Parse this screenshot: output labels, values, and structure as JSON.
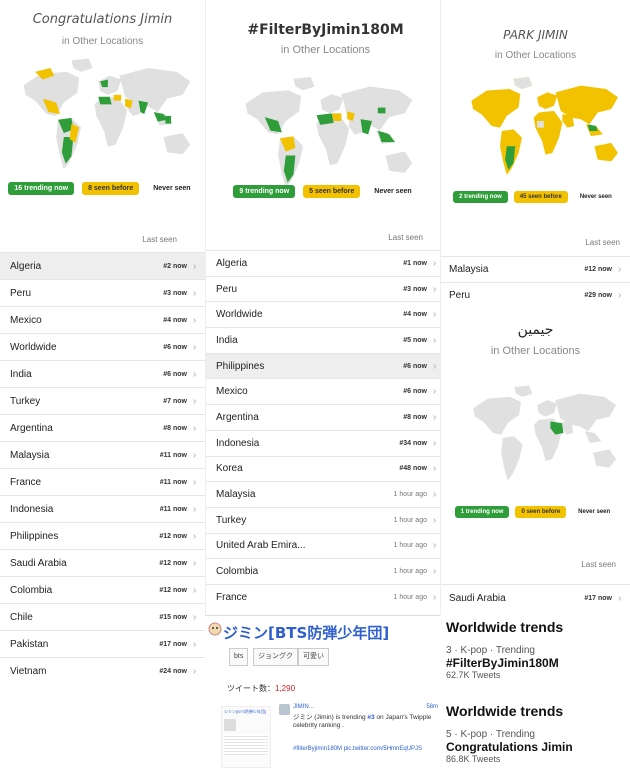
{
  "colors": {
    "green": "#2f9e3a",
    "yellow": "#f2c200",
    "land": "#e0e0e0",
    "link": "#2f5fcf"
  },
  "common": {
    "subtitle": "in Other Locations",
    "last_seen": "Last seen",
    "chevron": "›"
  },
  "panel1": {
    "title": "Congratulations Jimin",
    "legend": {
      "trending": "16 trending now",
      "before": "8 seen before",
      "never": "Never seen"
    },
    "rows": [
      {
        "name": "Algeria",
        "status": "#2 now"
      },
      {
        "name": "Peru",
        "status": "#3 now"
      },
      {
        "name": "Mexico",
        "status": "#4 now"
      },
      {
        "name": "Worldwide",
        "status": "#6 now"
      },
      {
        "name": "India",
        "status": "#6 now"
      },
      {
        "name": "Turkey",
        "status": "#7 now"
      },
      {
        "name": "Argentina",
        "status": "#8 now"
      },
      {
        "name": "Malaysia",
        "status": "#11 now"
      },
      {
        "name": "France",
        "status": "#11 now"
      },
      {
        "name": "Indonesia",
        "status": "#11 now"
      },
      {
        "name": "Philippines",
        "status": "#12 now"
      },
      {
        "name": "Saudi Arabia",
        "status": "#12 now"
      },
      {
        "name": "Colombia",
        "status": "#12 now"
      },
      {
        "name": "Chile",
        "status": "#15 now"
      },
      {
        "name": "Pakistan",
        "status": "#17 now"
      },
      {
        "name": "Vietnam",
        "status": "#24 now"
      }
    ]
  },
  "panel2": {
    "title": "#FilterByJimin180M",
    "legend": {
      "trending": "9 trending now",
      "before": "5 seen before",
      "never": "Never seen"
    },
    "rows": [
      {
        "name": "Algeria",
        "status": "#1 now"
      },
      {
        "name": "Peru",
        "status": "#3 now"
      },
      {
        "name": "Worldwide",
        "status": "#4 now"
      },
      {
        "name": "India",
        "status": "#5 now"
      },
      {
        "name": "Philippines",
        "status": "#6 now"
      },
      {
        "name": "Mexico",
        "status": "#6 now"
      },
      {
        "name": "Argentina",
        "status": "#8 now"
      },
      {
        "name": "Indonesia",
        "status": "#34 now"
      },
      {
        "name": "Korea",
        "status": "#48 now"
      },
      {
        "name": "Malaysia",
        "status": "1 hour ago"
      },
      {
        "name": "Turkey",
        "status": "1 hour ago"
      },
      {
        "name": "United Arab Emira...",
        "status": "1 hour ago"
      },
      {
        "name": "Colombia",
        "status": "1 hour ago"
      },
      {
        "name": "France",
        "status": "1 hour ago"
      }
    ]
  },
  "panel3": {
    "title": "PARK JIMIN",
    "legend": {
      "trending": "2 trending now",
      "before": "45 seen before",
      "never": "Never seen"
    },
    "rows": [
      {
        "name": "Malaysia",
        "status": "#12 now"
      },
      {
        "name": "Peru",
        "status": "#29 now"
      }
    ]
  },
  "panel4": {
    "title": "جيمين",
    "legend": {
      "trending": "1 trending now",
      "before": "0 seen before",
      "never": "Never seen"
    },
    "rows": [
      {
        "name": "Saudi Arabia",
        "status": "#17 now"
      }
    ]
  },
  "worldwide": [
    {
      "heading": "Worldwide trends",
      "meta": "3 · K-pop · Trending",
      "name": "#FilterByJimin180M",
      "count": "62.7K Tweets"
    },
    {
      "heading": "Worldwide trends",
      "meta": "5 · K-pop · Trending",
      "name": "Congratulations Jimin",
      "count": "86.8K Tweets"
    }
  ],
  "jp": {
    "title": "ジミン[BTS防弾少年団]",
    "tags": [
      "bts",
      "ジョングク",
      "可愛い"
    ],
    "count_label": "ツイート数：",
    "count_value": "1,290",
    "tweet_user": "JIMIN…",
    "tweet_time": "58m",
    "tweet_text_a": "ジミン (Jimin) is trending ",
    "tweet_rank": "#3",
    "tweet_text_b": " on Japan's Twipple celebrity ranking .",
    "tweet_link": "#filterByjimin180M pic.twitter.com/5HmnEqUPJS",
    "card_title": "ジミン[BTS防弾少年団]"
  }
}
